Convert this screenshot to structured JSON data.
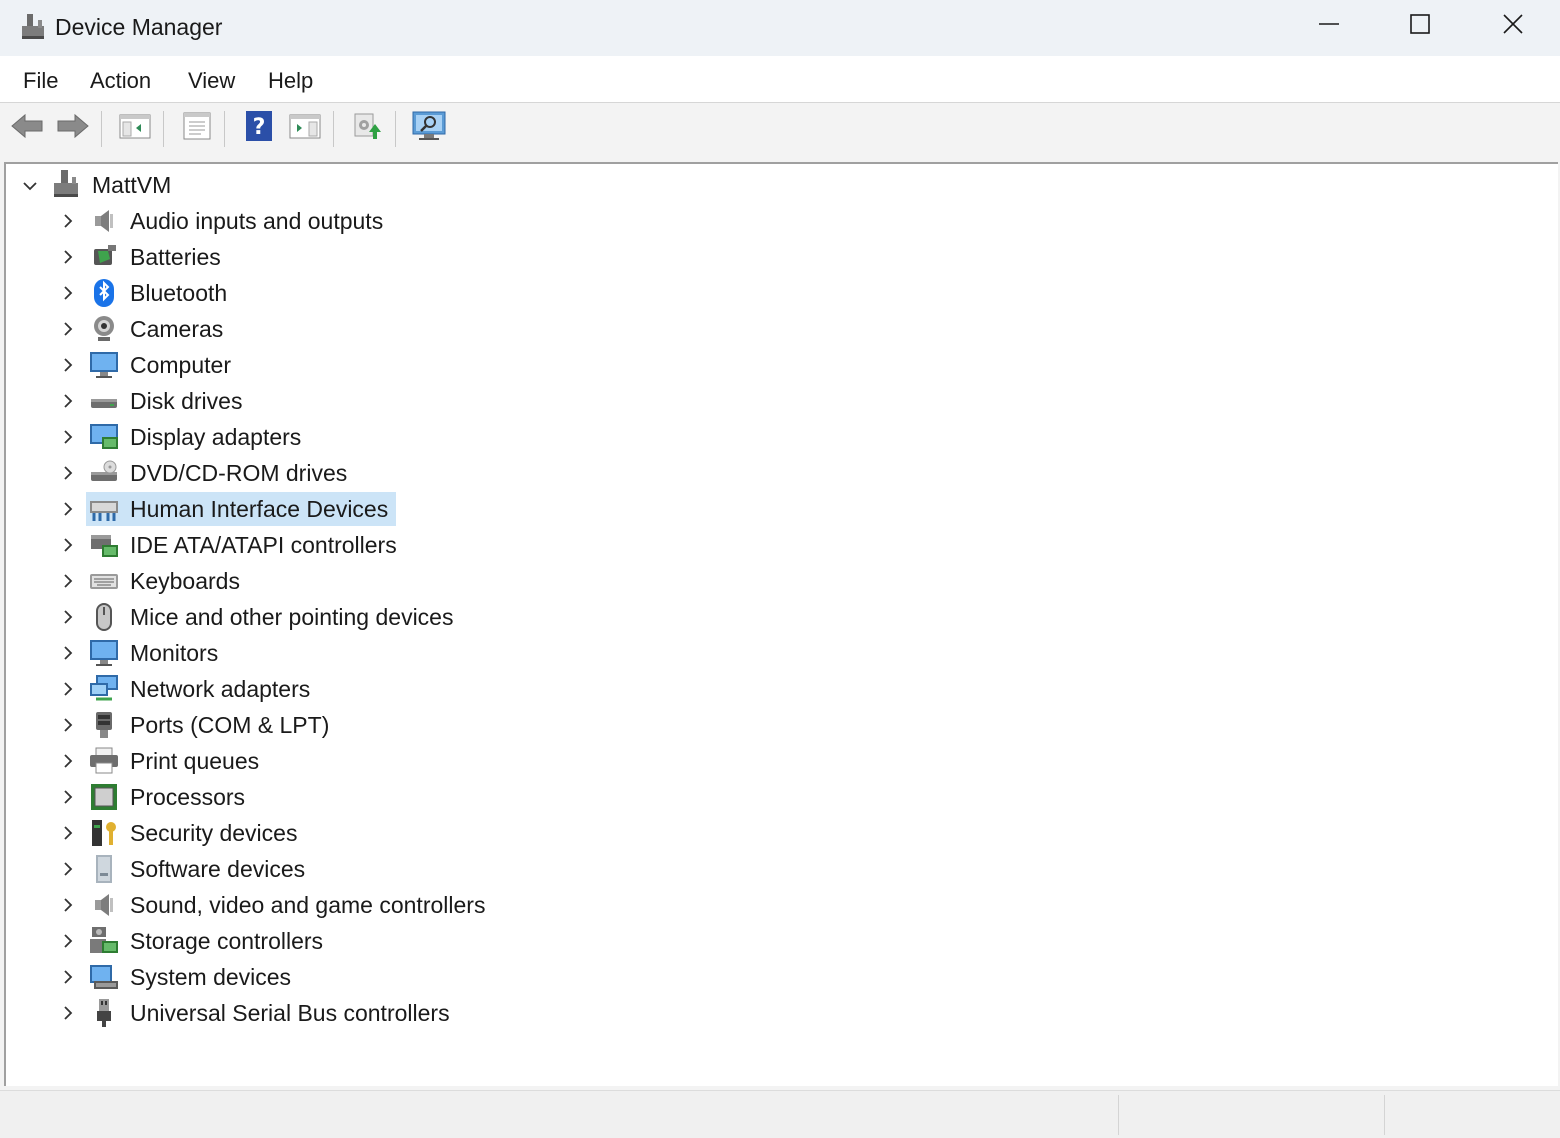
{
  "window": {
    "title": "Device Manager",
    "controls": [
      "minimize",
      "maximize",
      "close"
    ]
  },
  "menu": {
    "file": "File",
    "action": "Action",
    "view": "View",
    "help": "Help"
  },
  "toolbar": {
    "buttons": [
      "back-icon",
      "forward-icon",
      "show-hide-console-tree-icon",
      "properties-icon",
      "help-icon",
      "show-action-pane-icon",
      "update-driver-icon",
      "scan-hardware-icon"
    ]
  },
  "tree": {
    "root": {
      "label": "MattVM",
      "expanded": true
    },
    "items": [
      {
        "label": "Audio inputs and outputs",
        "icon": "speaker-icon"
      },
      {
        "label": "Batteries",
        "icon": "battery-icon"
      },
      {
        "label": "Bluetooth",
        "icon": "bluetooth-icon"
      },
      {
        "label": "Cameras",
        "icon": "camera-icon"
      },
      {
        "label": "Computer",
        "icon": "computer-icon"
      },
      {
        "label": "Disk drives",
        "icon": "disk-drive-icon"
      },
      {
        "label": "Display adapters",
        "icon": "display-adapter-icon"
      },
      {
        "label": "DVD/CD-ROM drives",
        "icon": "dvd-drive-icon"
      },
      {
        "label": "Human Interface Devices",
        "icon": "hid-icon",
        "selected": true
      },
      {
        "label": "IDE ATA/ATAPI controllers",
        "icon": "ide-controller-icon"
      },
      {
        "label": "Keyboards",
        "icon": "keyboard-icon"
      },
      {
        "label": "Mice and other pointing devices",
        "icon": "mouse-icon"
      },
      {
        "label": "Monitors",
        "icon": "monitor-icon"
      },
      {
        "label": "Network adapters",
        "icon": "network-adapter-icon"
      },
      {
        "label": "Ports (COM & LPT)",
        "icon": "port-icon"
      },
      {
        "label": "Print queues",
        "icon": "printer-icon"
      },
      {
        "label": "Processors",
        "icon": "processor-icon"
      },
      {
        "label": "Security devices",
        "icon": "security-device-icon"
      },
      {
        "label": "Software devices",
        "icon": "software-device-icon"
      },
      {
        "label": "Sound, video and game controllers",
        "icon": "sound-controller-icon"
      },
      {
        "label": "Storage controllers",
        "icon": "storage-controller-icon"
      },
      {
        "label": "System devices",
        "icon": "system-device-icon"
      },
      {
        "label": "Universal Serial Bus controllers",
        "icon": "usb-icon"
      }
    ]
  },
  "colors": {
    "selection": "#cce4f7",
    "titlebar": "#eef2f6",
    "pane": "#ffffff"
  }
}
